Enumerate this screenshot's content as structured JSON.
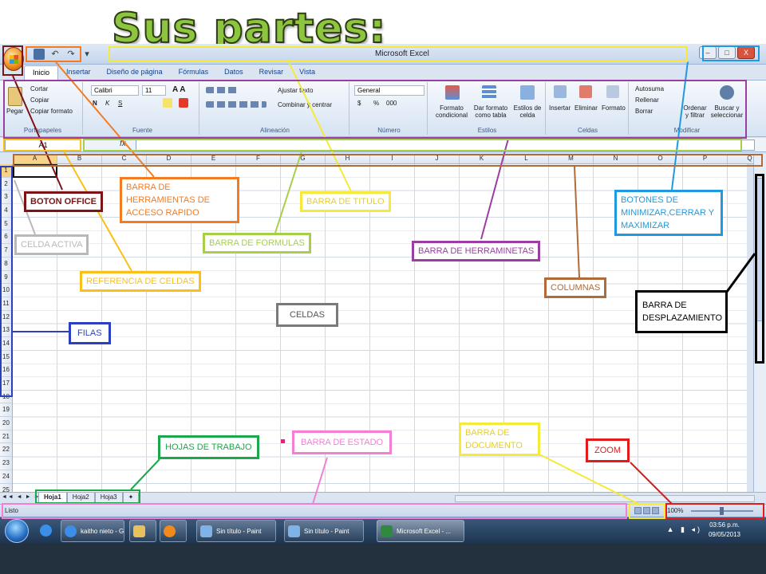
{
  "slide_title": "Sus partes:",
  "window": {
    "title": "Microsoft Excel",
    "controls": [
      "–",
      "□",
      "X"
    ]
  },
  "qat_icons": [
    "save-icon",
    "undo-icon",
    "redo-icon",
    "customize-icon"
  ],
  "tabs": [
    "Inicio",
    "Insertar",
    "Diseño de página",
    "Fórmulas",
    "Datos",
    "Revisar",
    "Vista"
  ],
  "ribbon": {
    "clipboard": {
      "paste": "Pegar",
      "cut": "Cortar",
      "copy": "Copiar",
      "format_painter": "Copiar formato",
      "label": "Portapapeles"
    },
    "font": {
      "name": "Calibri",
      "size": "11",
      "bold": "N",
      "italic": "K",
      "underline": "S",
      "label": "Fuente"
    },
    "alignment": {
      "wrap": "Ajustar texto",
      "merge": "Combinar y centrar",
      "label": "Alineación"
    },
    "number": {
      "format": "General",
      "currency": "$",
      "percent": "%",
      "thousands": "000",
      "label": "Número"
    },
    "styles": {
      "conditional": "Formato condicional",
      "as_table": "Dar formato como tabla",
      "cell_styles": "Estilos de celda",
      "label": "Estilos"
    },
    "cells": {
      "insert": "Insertar",
      "delete": "Eliminar",
      "format": "Formato",
      "label": "Celdas"
    },
    "editing": {
      "autosum": "Autosuma",
      "fill": "Rellenar",
      "clear": "Borrar",
      "sort": "Ordenar y filtrar",
      "find": "Buscar y seleccionar",
      "label": "Modificar"
    }
  },
  "formula_bar": {
    "name_box": "A1",
    "fx": "fx",
    "value": ""
  },
  "columns": [
    "A",
    "B",
    "C",
    "D",
    "E",
    "F",
    "G",
    "H",
    "I",
    "J",
    "K",
    "L",
    "M",
    "N",
    "O",
    "P",
    "Q"
  ],
  "rows": [
    "1",
    "2",
    "3",
    "4",
    "5",
    "6",
    "7",
    "8",
    "9",
    "10",
    "11",
    "12",
    "13",
    "14",
    "15",
    "16",
    "17",
    "18",
    "19",
    "20",
    "21",
    "22",
    "23",
    "24",
    "25"
  ],
  "sheets": [
    "Hoja1",
    "Hoja2",
    "Hoja3"
  ],
  "status": {
    "text": "Listo",
    "zoom": "100%"
  },
  "taskbar": {
    "items": [
      "kaitho nieto - Go...",
      "Sin título - Paint",
      "Sin título - Paint",
      "Microsoft Excel - ..."
    ],
    "time": "03:56 p.m.",
    "date": "09/05/2013"
  },
  "annotations": {
    "boton_office": {
      "text": "BOTON OFFICE",
      "color": "#7b1416"
    },
    "barra_acceso_rapido": {
      "text": "BARRA DE HERRAMIENTAS DE ACCESO RAPIDO",
      "color": "#f47b20"
    },
    "barra_titulo": {
      "text": "BARRA DE TITULO",
      "color": "#f5e93a"
    },
    "botones_ventana": {
      "text": "BOTONES DE MINIMIZAR,CERRAR Y MAXIMIZAR",
      "color": "#1f9ae0"
    },
    "celda_activa": {
      "text": "CELDA ACTIVA",
      "color": "#b9b9b9"
    },
    "barra_formulas": {
      "text": "BARRA DE FORMULAS",
      "color": "#a6d04a"
    },
    "barra_herramientas": {
      "text": "BARRA DE HERRAMINETAS",
      "color": "#9b3ea2"
    },
    "referencia_celdas": {
      "text": "REFERENCIA DE CELDAS",
      "color": "#fbbf1a"
    },
    "columnas": {
      "text": "COLUMNAS",
      "color": "#b26a38"
    },
    "celdas": {
      "text": "CELDAS",
      "color": "#7a7a7a"
    },
    "barra_desplazamiento": {
      "text": "BARRA DE DESPLAZAMIENTO",
      "color": "#000000"
    },
    "filas": {
      "text": "FILAS",
      "color": "#2b3fbf"
    },
    "hojas_trabajo": {
      "text": "HOJAS DE TRABAJO",
      "color": "#1aa84a"
    },
    "barra_estado": {
      "text": "BARRA DE ESTADO",
      "color": "#f27fd5"
    },
    "barra_documento": {
      "text": "BARRA DE DOCUMENTO",
      "color": "#f5e93a"
    },
    "zoom": {
      "text": "ZOOM",
      "color": "#e21b1b"
    }
  }
}
